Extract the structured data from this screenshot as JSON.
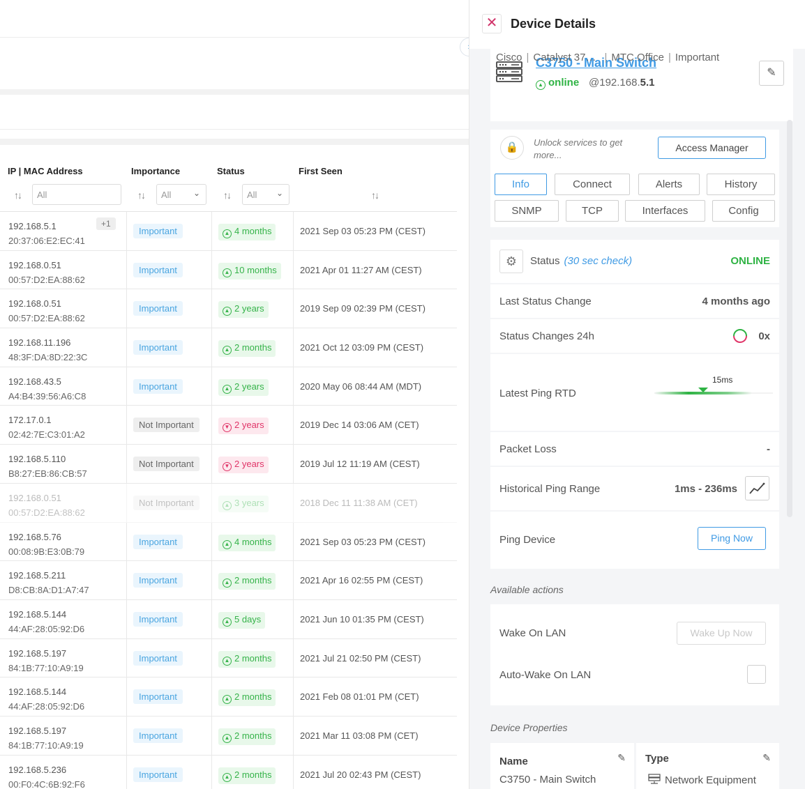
{
  "table": {
    "headers": {
      "ip": "IP | MAC Address",
      "importance": "Importance",
      "status": "Status",
      "first_seen": "First Seen"
    },
    "filters": {
      "ip_placeholder": "All",
      "importance": "All",
      "status": "All"
    },
    "sort_icon": "sort-icon",
    "rows": [
      {
        "ip": "192.168.5.1",
        "mac": "20:37:06:E2:EC:41",
        "extra": "+1",
        "importance": "Important",
        "status": "4 months",
        "state": "up",
        "first_seen": "2021 Sep 03 05:23 PM (CEST)"
      },
      {
        "ip": "192.168.0.51",
        "mac": "00:57:D2:EA:88:62",
        "importance": "Important",
        "status": "10 months",
        "state": "up",
        "first_seen": "2021 Apr 01 11:27 AM (CEST)"
      },
      {
        "ip": "192.168.0.51",
        "mac": "00:57:D2:EA:88:62",
        "importance": "Important",
        "status": "2 years",
        "state": "up",
        "first_seen": "2019 Sep 09 02:39 PM (CEST)"
      },
      {
        "ip": "192.168.11.196",
        "mac": "48:3F:DA:8D:22:3C",
        "importance": "Important",
        "status": "2 months",
        "state": "up",
        "first_seen": "2021 Oct 12 03:09 PM (CEST)"
      },
      {
        "ip": "192.168.43.5",
        "mac": "A4:B4:39:56:A6:C8",
        "importance": "Important",
        "status": "2 years",
        "state": "up",
        "first_seen": "2020 May 06 08:44 AM (MDT)"
      },
      {
        "ip": "172.17.0.1",
        "mac": "02:42:7E:C3:01:A2",
        "importance": "Not Important",
        "status": "2 years",
        "state": "down",
        "first_seen": "2019 Dec 14 03:06 AM (CET)"
      },
      {
        "ip": "192.168.5.110",
        "mac": "B8:27:EB:86:CB:57",
        "importance": "Not Important",
        "status": "2 years",
        "state": "down",
        "first_seen": "2019 Jul 12 11:19 AM (CEST)"
      },
      {
        "ip": "192.168.0.51",
        "mac": "00:57:D2:EA:88:62",
        "importance": "Not Important",
        "status": "3 years",
        "state": "dim",
        "first_seen": "2018 Dec 11 11:38 AM (CET)"
      },
      {
        "ip": "192.168.5.76",
        "mac": "00:08:9B:E3:0B:79",
        "importance": "Important",
        "status": "4 months",
        "state": "up",
        "first_seen": "2021 Sep 03 05:23 PM (CEST)"
      },
      {
        "ip": "192.168.5.211",
        "mac": "D8:CB:8A:D1:A7:47",
        "importance": "Important",
        "status": "2 months",
        "state": "up",
        "first_seen": "2021 Apr 16 02:55 PM (CEST)"
      },
      {
        "ip": "192.168.5.144",
        "mac": "44:AF:28:05:92:D6",
        "importance": "Important",
        "status": "5 days",
        "state": "up",
        "first_seen": "2021 Jun 10 01:35 PM (CEST)"
      },
      {
        "ip": "192.168.5.197",
        "mac": "84:1B:77:10:A9:19",
        "importance": "Important",
        "status": "2 months",
        "state": "up",
        "first_seen": "2021 Jul 21 02:50 PM (CEST)"
      },
      {
        "ip": "192.168.5.144",
        "mac": "44:AF:28:05:92:D6",
        "importance": "Important",
        "status": "2 months",
        "state": "up",
        "first_seen": "2021 Feb 08 01:01 PM (CET)"
      },
      {
        "ip": "192.168.5.197",
        "mac": "84:1B:77:10:A9:19",
        "importance": "Important",
        "status": "2 months",
        "state": "up",
        "first_seen": "2021 Mar 11 03:08 PM (CET)"
      },
      {
        "ip": "192.168.5.236",
        "mac": "00:F0:4C:6B:92:F6",
        "importance": "Important",
        "status": "2 months",
        "state": "up",
        "first_seen": "2021 Jul 20 02:43 PM (CEST)"
      }
    ]
  },
  "panel": {
    "title": "Device Details",
    "close_glyph": "✕",
    "collapse_glyph": "›",
    "device": {
      "name": "C3750 - Main Switch",
      "status": "online",
      "ip_prefix": "@192.168.",
      "ip_suffix": "5.1",
      "tags": [
        "Cisco",
        "Catalyst 37…",
        "MTC Office",
        "Important"
      ],
      "icon": "server-icon"
    },
    "unlock_text": "Unlock services to get more...",
    "access_manager": "Access Manager",
    "tabs": [
      "Info",
      "Connect",
      "Alerts",
      "History",
      "SNMP",
      "TCP",
      "Interfaces",
      "Config"
    ],
    "active_tab": "Info",
    "status": {
      "label": "Status",
      "sub": "(30 sec check)",
      "value": "ONLINE"
    },
    "last_status_change": {
      "label": "Last Status Change",
      "value": "4 months ago"
    },
    "status_changes": {
      "label": "Status Changes 24h",
      "value": "0x"
    },
    "latest_ping": {
      "label": "Latest Ping RTD",
      "value": "15ms"
    },
    "packet_loss": {
      "label": "Packet Loss",
      "value": "-"
    },
    "hist_ping": {
      "label": "Historical Ping Range",
      "value": "1ms - 236ms"
    },
    "ping_device": {
      "label": "Ping Device",
      "button": "Ping Now"
    },
    "available_actions": "Available actions",
    "wake_on_lan": {
      "label": "Wake On LAN",
      "button": "Wake Up Now"
    },
    "auto_wake": {
      "label": "Auto-Wake On LAN"
    },
    "device_properties": "Device Properties",
    "props": [
      {
        "label": "Name",
        "value": "C3750 - Main Switch"
      },
      {
        "label": "Type",
        "value": "Network Equipment"
      }
    ],
    "colors": {
      "accent": "#3f9ae4",
      "online": "#2fb344",
      "danger": "#e03468"
    }
  }
}
